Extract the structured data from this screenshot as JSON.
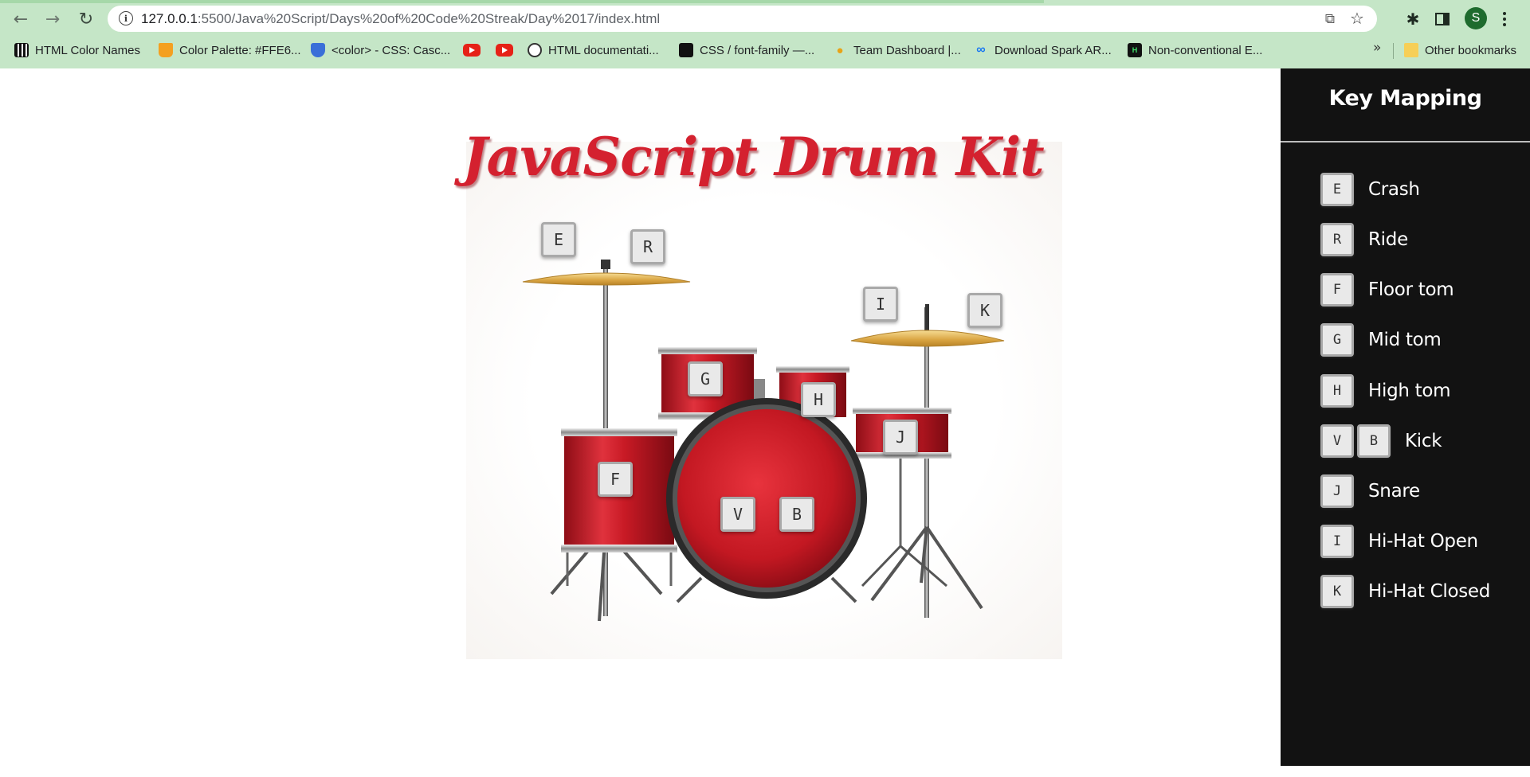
{
  "browser": {
    "url_host": "127.0.0.1",
    "url_path": ":5500/Java%20Script/Days%20of%20Code%20Streak/Day%2017/index.html",
    "profile_initial": "S",
    "bookmarks": [
      {
        "label": "HTML Color Names",
        "icon": "piano-icon"
      },
      {
        "label": "Color Palette: #FFE6...",
        "icon": "cup-icon"
      },
      {
        "label": "<color> - CSS: Casc...",
        "icon": "shield-icon"
      },
      {
        "label": "",
        "icon": "youtube-icon"
      },
      {
        "label": "",
        "icon": "youtube-icon"
      },
      {
        "label": "HTML documentati...",
        "icon": "github-icon"
      },
      {
        "label": "CSS / font-family —...",
        "icon": "css-icon"
      },
      {
        "label": "Team Dashboard |...",
        "icon": "pin-icon"
      },
      {
        "label": "Download Spark AR...",
        "icon": "meta-icon"
      },
      {
        "label": "Non-conventional E...",
        "icon": "hb-icon"
      }
    ],
    "more_bookmarks": "»",
    "other_bookmarks": "Other bookmarks"
  },
  "page": {
    "title": "JavaScript Drum Kit",
    "keys": {
      "crash": "E",
      "ride": "R",
      "hihat_open": "I",
      "hihat_closed": "K",
      "mid_tom": "G",
      "high_tom": "H",
      "floor_tom": "F",
      "snare": "J",
      "kick1": "V",
      "kick2": "B"
    }
  },
  "sidebar": {
    "title": "Key Mapping",
    "items": [
      {
        "keys": [
          "E"
        ],
        "label": "Crash"
      },
      {
        "keys": [
          "R"
        ],
        "label": "Ride"
      },
      {
        "keys": [
          "F"
        ],
        "label": "Floor tom"
      },
      {
        "keys": [
          "G"
        ],
        "label": "Mid tom"
      },
      {
        "keys": [
          "H"
        ],
        "label": "High tom"
      },
      {
        "keys": [
          "V",
          "B"
        ],
        "label": "Kick"
      },
      {
        "keys": [
          "J"
        ],
        "label": "Snare"
      },
      {
        "keys": [
          "I"
        ],
        "label": "Hi-Hat Open"
      },
      {
        "keys": [
          "K"
        ],
        "label": "Hi-Hat Closed"
      }
    ]
  },
  "colors": {
    "title_red": "#d4212f",
    "drum_red": "#c81a25",
    "cymbal_gold": "#e2b24f",
    "sidebar_bg": "#121212",
    "chrome_green": "#c5e6c7"
  }
}
